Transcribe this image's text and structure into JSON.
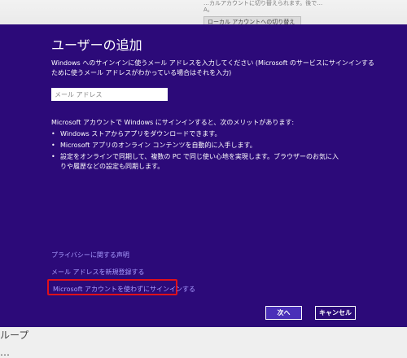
{
  "background": {
    "line1": "…カルアカウントに切り替えられます。後で…",
    "line2": "A。",
    "switch_button": "ローカル アカウントへの切り替え",
    "bottom_1": "ループ",
    "bottom_2": "…"
  },
  "dialog": {
    "title": "ユーザーの追加",
    "description": "Windows へのサインインに使うメール アドレスを入力してください (Microsoft のサービスにサインインするために使うメール アドレスがわかっている場合はそれを入力)",
    "email_placeholder": "メール アドレス",
    "benefits_intro": "Microsoft アカウントで Windows にサインインすると、次のメリットがあります:",
    "benefits": [
      "Windows ストアからアプリをダウンロードできます。",
      "Microsoft アプリのオンライン コンテンツを自動的に入手します。",
      "設定をオンラインで同期して、複数の PC で同じ使い心地を実現します。ブラウザーのお気に入りや履歴などの設定も同期します。"
    ],
    "links": {
      "privacy": "プライバシーに関する声明",
      "register": "メール アドレスを新規登録する",
      "no_msa": "Microsoft アカウントを使わずにサインインする"
    },
    "buttons": {
      "next": "次へ",
      "cancel": "キャンセル"
    }
  },
  "colors": {
    "dialog_bg": "#2c0a79",
    "link": "#a99cff",
    "highlight": "#e0101a"
  }
}
